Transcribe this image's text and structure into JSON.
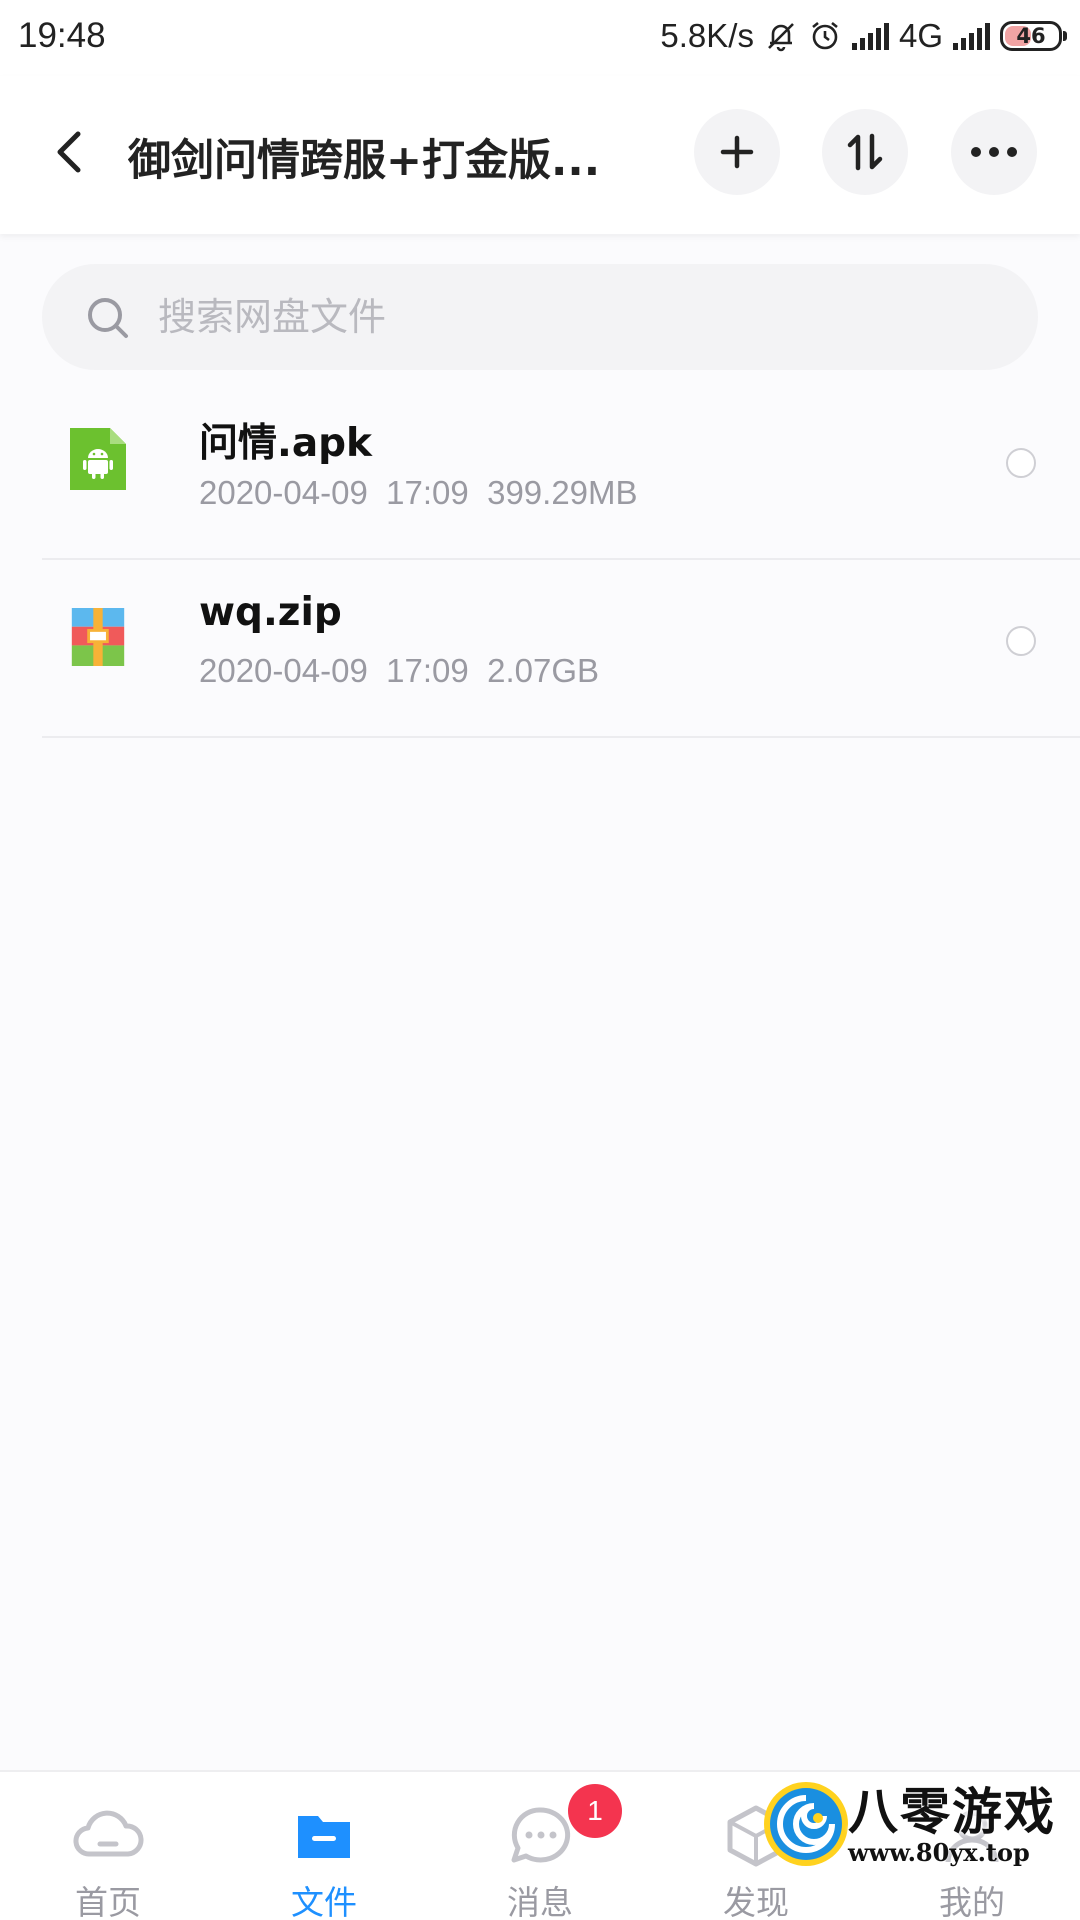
{
  "status_bar": {
    "time": "19:48",
    "net_speed": "5.8K/s",
    "network_type": "4G",
    "battery": "46",
    "icons": [
      "mute-icon",
      "alarm-icon",
      "signal-icon",
      "signal-icon-2"
    ]
  },
  "header": {
    "title": "御剑问情跨服+打金版...",
    "icons": [
      "back-icon",
      "plus-icon",
      "sort-icon",
      "more-icon"
    ]
  },
  "search": {
    "placeholder": "搜索网盘文件",
    "value": ""
  },
  "files": [
    {
      "name": "问情.apk",
      "date": "2020-04-09",
      "time": "17:09",
      "size": "399.29MB",
      "icon": "apk-file-icon",
      "selected": false
    },
    {
      "name": "wq.zip",
      "date": "2020-04-09",
      "time": "17:09",
      "size": "2.07GB",
      "icon": "zip-file-icon",
      "selected": false
    }
  ],
  "bottom_nav": {
    "items": [
      {
        "label": "首页",
        "icon": "cloud-icon",
        "active": false
      },
      {
        "label": "文件",
        "icon": "folder-icon",
        "active": true
      },
      {
        "label": "消息",
        "icon": "chat-icon",
        "active": false,
        "badge": "1"
      },
      {
        "label": "发现",
        "icon": "discover-icon",
        "active": false
      },
      {
        "label": "我的",
        "icon": "profile-icon",
        "active": false
      }
    ]
  },
  "watermark": {
    "title": "八零游戏",
    "url": "www.80yx.top"
  },
  "colors": {
    "accent": "#1e90ff",
    "badge": "#f4344f",
    "apk_icon": "#6cc12f",
    "meta_text": "#9a9aa2"
  }
}
